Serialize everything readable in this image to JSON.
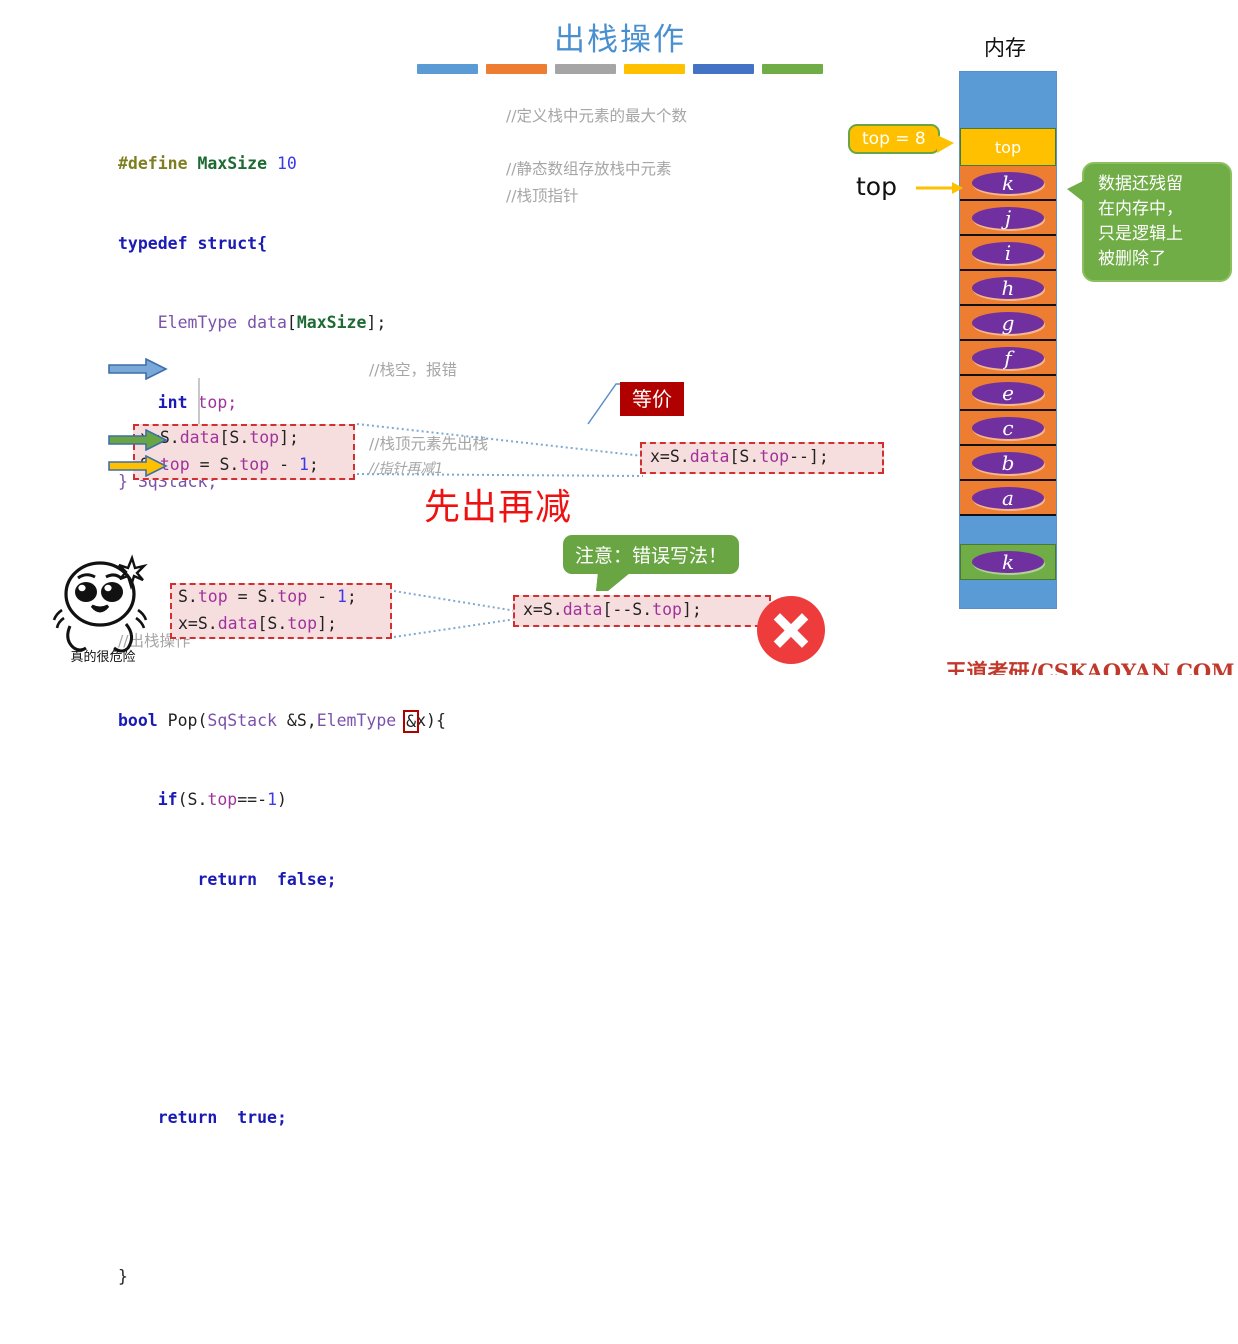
{
  "slide": {
    "title": "出栈操作",
    "accent_bars": [
      "#5b9bd5",
      "#ed7d31",
      "#a5a5a5",
      "#ffc000",
      "#4472c4",
      "#70ad47"
    ],
    "footer": "王道考研/CSKAOYAN.COM"
  },
  "code": {
    "lines": [
      {
        "id": "l1",
        "text": "#define MaxSize 10"
      },
      {
        "id": "l2",
        "text": "typedef struct{"
      },
      {
        "id": "l3",
        "text": "    ElemType data[MaxSize];"
      },
      {
        "id": "l4",
        "text": "    int top;"
      },
      {
        "id": "l5",
        "text": "} SqStack;"
      },
      {
        "id": "l6",
        "text": "//出栈操作"
      },
      {
        "id": "l7",
        "text": "bool Pop(SqStack &S,ElemType &x){"
      },
      {
        "id": "l8",
        "text": "    if(S.top==-1)"
      },
      {
        "id": "l9",
        "text": "        return  false;"
      },
      {
        "id": "l10",
        "text": "    x=S.data[S.top];"
      },
      {
        "id": "l11",
        "text": "    S.top = S.top - 1;"
      },
      {
        "id": "l12",
        "text": "    return  true;"
      },
      {
        "id": "l13",
        "text": "}"
      }
    ],
    "tokens": {
      "define": "#define",
      "maxsize": "MaxSize",
      "ten": "10",
      "typedef": "typedef",
      "struct": "struct{",
      "elemtype": "ElemType",
      "data_decl": "data",
      "bracket_open": "[",
      "bracket_close": "];",
      "int": "int",
      "top": "top;",
      "close_struct": "} SqStack;",
      "bool": "bool",
      "pop": " Pop(",
      "sqstack": "SqStack",
      "amp_s": " &S,",
      "elemtype2": "ElemType",
      "amp": "&",
      "x_paren": "x){",
      "if": "if",
      "if_cond_a": "(S.",
      "if_top": "top",
      "if_eq": "==-",
      "if_one": "1",
      "if_close": ")",
      "return": "return",
      "false": "false;",
      "true": "true;",
      "closebrace": "}"
    },
    "comments": {
      "c1": "//定义栈中元素的最大个数",
      "c2": "//静态数组存放栈中元素",
      "c3": "//栈顶指针",
      "c4": "//出栈操作",
      "c5": "//栈空，报错",
      "c6": "//栈顶元素先出栈",
      "c7": "//指针再减1"
    }
  },
  "highlight_box": {
    "line1_a": "x=S.",
    "line1_b": "data",
    "line1_c": "[S.",
    "line1_d": "top",
    "line1_e": "];",
    "line2_a": "S.",
    "line2_b": "top",
    "line2_c": " = S.",
    "line2_d": "top",
    "line2_e": " - ",
    "line2_f": "1",
    "line2_g": ";"
  },
  "equiv": {
    "chip_label": "等价",
    "code_a": "x=S.",
    "code_b": "data",
    "code_c": "[S.",
    "code_d": "top",
    "code_e": "--];"
  },
  "emphasis": {
    "big_red": "先出再减"
  },
  "wrong": {
    "bubble": "注意：错误写法！",
    "box_line1_a": "S.",
    "box_line1_b": "top",
    "box_line1_c": " = S.",
    "box_line1_d": "top",
    "box_line1_e": " - ",
    "box_line1_f": "1",
    "box_line1_g": ";",
    "box_line2_a": "x=S.",
    "box_line2_b": "data",
    "box_line2_c": "[S.",
    "box_line2_d": "top",
    "box_line2_e": "];",
    "result_a": "x=S.",
    "result_b": "data",
    "result_c": "[--S.",
    "result_d": "top",
    "result_e": "];",
    "x_mark": "✕"
  },
  "mascot": {
    "caption": "真的很危险"
  },
  "memory": {
    "title": "内存",
    "top_callout": "top = 8",
    "top_pointer_label": "top",
    "top_cell_label": "top",
    "note": "数据还残留在内存中，只是逻辑上被删除了",
    "note_lines": [
      "数据还残留",
      "在内存中，",
      "只是逻辑上",
      "被删除了"
    ],
    "cells": [
      {
        "kind": "blue",
        "label": ""
      },
      {
        "kind": "blue",
        "label": ""
      },
      {
        "kind": "yellow",
        "label": "top"
      },
      {
        "kind": "orange",
        "label": "k"
      },
      {
        "kind": "orange",
        "label": "j"
      },
      {
        "kind": "orange",
        "label": "i"
      },
      {
        "kind": "orange",
        "label": "h"
      },
      {
        "kind": "orange",
        "label": "g"
      },
      {
        "kind": "orange",
        "label": "f"
      },
      {
        "kind": "orange",
        "label": "e"
      },
      {
        "kind": "orange",
        "label": "c"
      },
      {
        "kind": "orange",
        "label": "b"
      },
      {
        "kind": "orange",
        "label": "a"
      },
      {
        "kind": "blue",
        "label": ""
      },
      {
        "kind": "green",
        "label": "k"
      },
      {
        "kind": "blue",
        "label": ""
      }
    ]
  },
  "colors": {
    "title_blue": "#4a90d0",
    "keyword_blue": "#1a1ab4",
    "type_purple": "#7b52ab",
    "member_magenta": "#a0339b",
    "const_green": "#1d6b33",
    "comment_gray": "#a6a6a6",
    "highlight_pink": "#f7dede",
    "dashed_red": "#d03030",
    "chip_red": "#b00000",
    "bubble_green": "#70ad47",
    "callout_yellow": "#ffc000",
    "cell_orange": "#ed7d31",
    "cell_blue": "#5b9bd5",
    "oval_purple": "#7030a0",
    "x_red": "#ee3b3b",
    "footer_red": "#c0392b"
  }
}
